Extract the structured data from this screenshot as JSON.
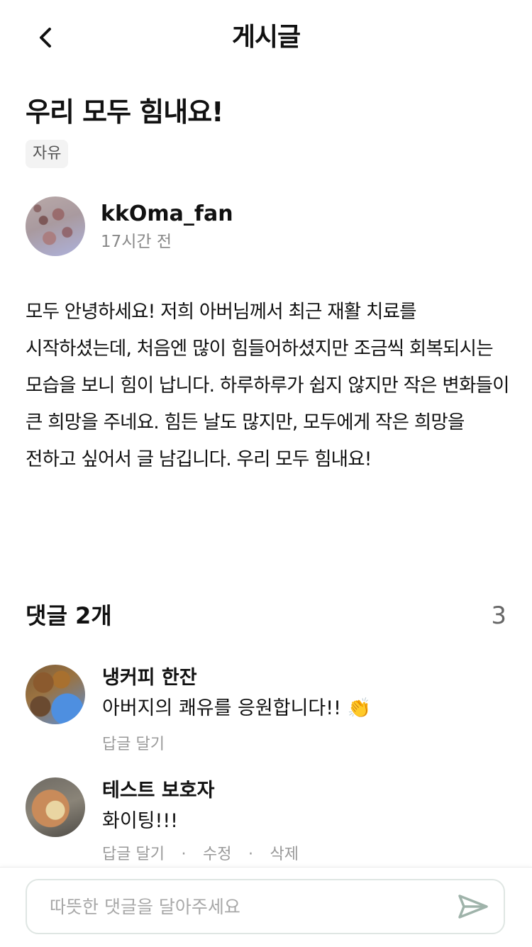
{
  "header": {
    "title": "게시글",
    "back_icon": "chevron-left-icon"
  },
  "post": {
    "title": "우리 모두 힘내요!",
    "category": "자유",
    "author": {
      "name": "kkOma_fan",
      "time": "17시간 전"
    },
    "body": "모두 안녕하세요! 저희 아버님께서 최근 재활 치료를 시작하셨는데, 처음엔 많이 힘들어하셨지만 조금씩 회복되시는 모습을 보니 힘이 납니다. 하루하루가 쉽지 않지만 작은 변화들이 큰 희망을 주네요. 힘든 날도 많지만, 모두에게 작은 희망을 전하고 싶어서 글 남깁니다. 우리 모두 힘내요!"
  },
  "comments_section": {
    "title": "댓글 2개",
    "count": "3"
  },
  "comments": [
    {
      "name": "냉커피 한잔",
      "text": "아버지의 쾌유를 응원합니다!! 👏",
      "reply_label": "답글 달기"
    },
    {
      "name": "테스트 보호자",
      "text": "화이팅!!!",
      "reply_label": "답글 달기",
      "edit_label": "수정",
      "delete_label": "삭제",
      "separator": "·"
    }
  ],
  "comment_input": {
    "placeholder": "따뜻한 댓글을 달아주세요",
    "value": "",
    "send_icon": "send-icon"
  },
  "colors": {
    "send_icon": "#9fb3aa",
    "input_border": "#dfe6e3"
  }
}
